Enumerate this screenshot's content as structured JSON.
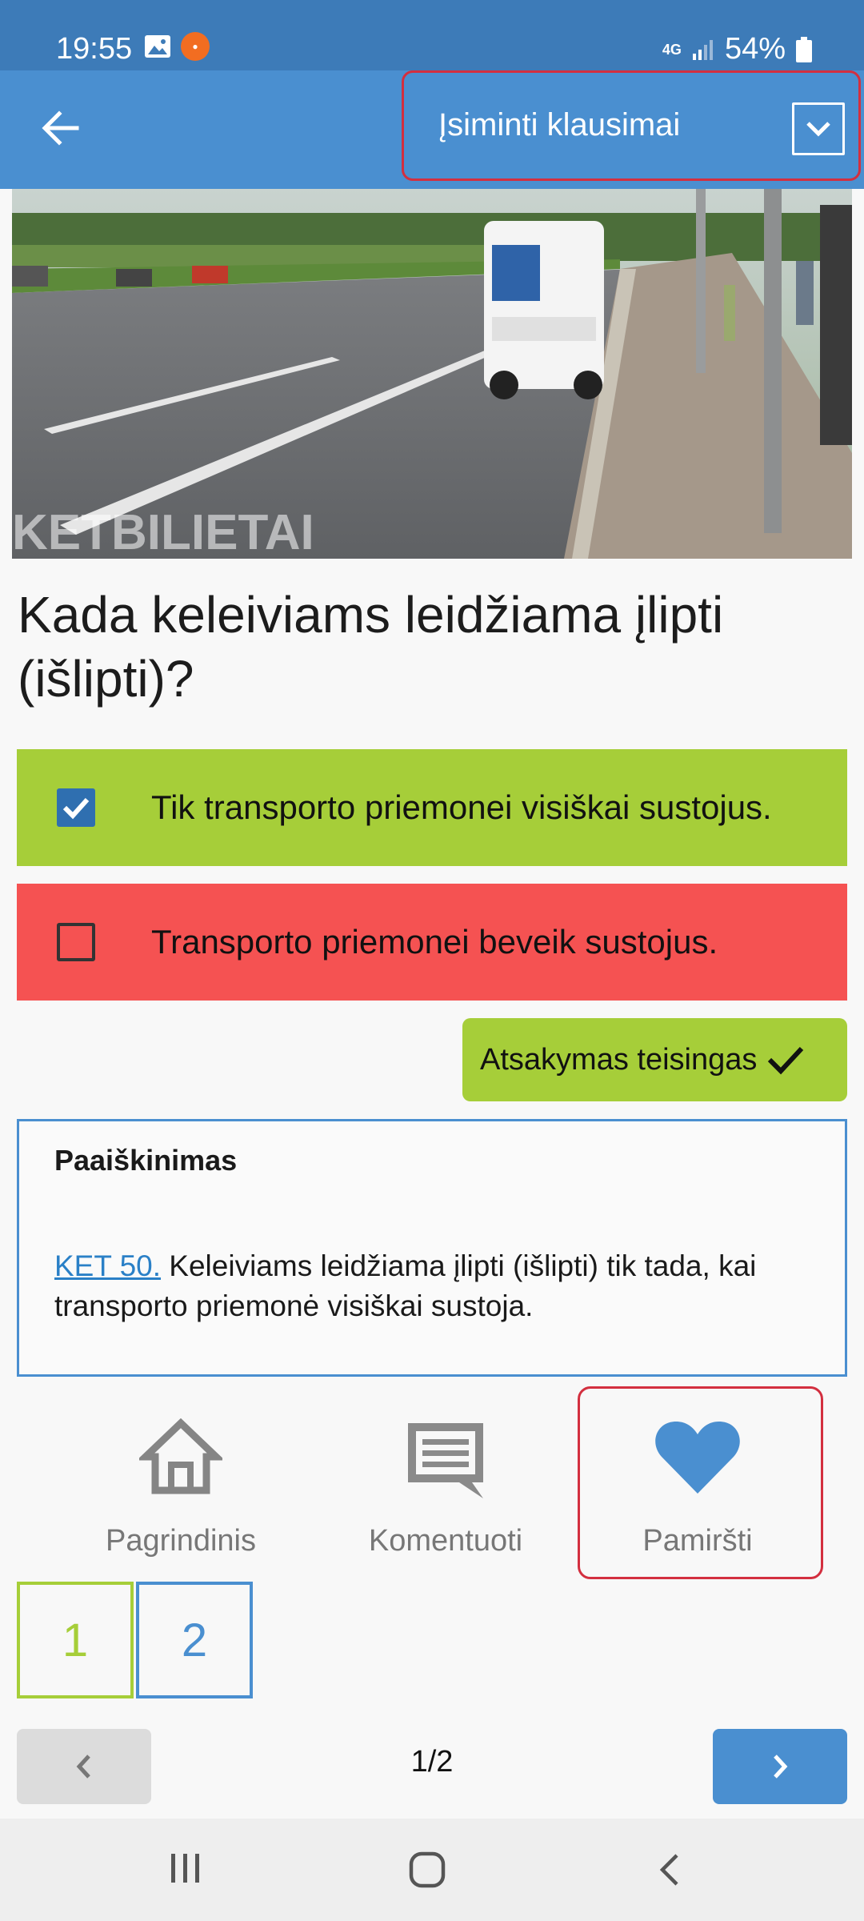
{
  "status_bar": {
    "time": "19:55",
    "network": "4G",
    "battery": "54%"
  },
  "app_bar": {
    "mode_label": "Įsiminti klausimai",
    "back_icon": "arrow-left-icon",
    "dropdown_icon": "chevron-down-icon"
  },
  "question": {
    "image_watermark": "KETBILIETAI",
    "text": "Kada keleiviams leidžiama įlipti (išlipti)?"
  },
  "answers": [
    {
      "text": "Tik transporto priemonei visiškai sustojus.",
      "checked": true,
      "color": "#a6ce39"
    },
    {
      "text": "Transporto priemonei beveik sustojus.",
      "checked": false,
      "color": "#f55252"
    }
  ],
  "result": {
    "label": "Atsakymas teisingas",
    "icon": "check-icon"
  },
  "explanation": {
    "title": "Paaiškinimas",
    "link": "KET 50.",
    "body": " Keleiviams leidžiama įlipti (išlipti) tik tada, kai transporto priemonė visiškai sustoja."
  },
  "bottom_actions": [
    {
      "label": "Pagrindinis",
      "icon": "home-icon"
    },
    {
      "label": "Komentuoti",
      "icon": "comment-icon"
    },
    {
      "label": "Pamiršti",
      "icon": "heart-icon"
    }
  ],
  "pages": [
    "1",
    "2"
  ],
  "pager": {
    "text": "1/2"
  },
  "colors": {
    "primary": "#4a8fd0",
    "correct": "#a6ce39",
    "wrong": "#f55252",
    "highlight_border": "#d32f3f"
  }
}
